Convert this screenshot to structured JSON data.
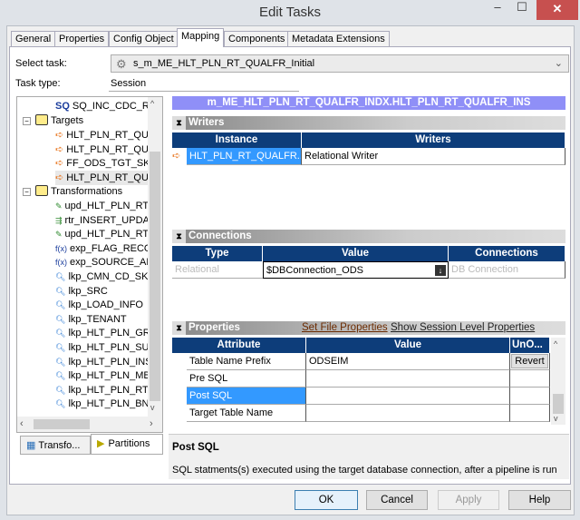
{
  "window": {
    "title": "Edit Tasks",
    "minimize": "–",
    "maximize": "☐",
    "close": "✕"
  },
  "tabs": [
    "General",
    "Properties",
    "Config Object",
    "Mapping",
    "Components",
    "Metadata Extensions"
  ],
  "select_task": {
    "label": "Select task:",
    "value": "s_m_ME_HLT_PLN_RT_QUALFR_Initial"
  },
  "task_type": {
    "label": "Task type:",
    "value": "Session"
  },
  "tree": {
    "sq": "SQ_INC_CDC_RA",
    "targets_label": "Targets",
    "targets": [
      "HLT_PLN_RT_QUA",
      "HLT_PLN_RT_QUA",
      "FF_ODS_TGT_SKI",
      "HLT_PLN_RT_QUA"
    ],
    "transformations_label": "Transformations",
    "transformations": [
      {
        "name": "upd_HLT_PLN_RT_",
        "type": "update"
      },
      {
        "name": "rtr_INSERT_UPDA",
        "type": "router"
      },
      {
        "name": "upd_HLT_PLN_RT_",
        "type": "update"
      },
      {
        "name": "exp_FLAG_RECOF",
        "type": "expression"
      },
      {
        "name": "exp_SOURCE_AN",
        "type": "expression"
      },
      {
        "name": "lkp_CMN_CD_SK_",
        "type": "lookup"
      },
      {
        "name": "lkp_SRC",
        "type": "lookup"
      },
      {
        "name": "lkp_LOAD_INFO",
        "type": "lookup"
      },
      {
        "name": "lkp_TENANT",
        "type": "lookup"
      },
      {
        "name": "lkp_HLT_PLN_GRC",
        "type": "lookup"
      },
      {
        "name": "lkp_HLT_PLN_SUB",
        "type": "lookup"
      },
      {
        "name": "lkp_HLT_PLN_INSF",
        "type": "lookup"
      },
      {
        "name": "lkp_HLT_PLN_MBR",
        "type": "lookup"
      },
      {
        "name": "lkp_HLT_PLN_RT_",
        "type": "lookup"
      },
      {
        "name": "lkp_HLT_PLN_BNF",
        "type": "lookup"
      }
    ]
  },
  "bottom_tabs": [
    "Transfo...",
    "Partitions"
  ],
  "mapping_title": "m_ME_HLT_PLN_RT_QUALFR_INDX.HLT_PLN_RT_QUALFR_INS",
  "writers": {
    "title": "Writers",
    "headers": [
      "Instance",
      "Writers"
    ],
    "rows": [
      [
        "HLT_PLN_RT_QUALFR...",
        "Relational Writer"
      ]
    ]
  },
  "connections": {
    "title": "Connections",
    "headers": [
      "Type",
      "Value",
      "Connections"
    ],
    "rows": [
      [
        "Relational",
        "$DBConnection_ODS",
        "DB Connection"
      ]
    ]
  },
  "properties": {
    "title": "Properties",
    "link1": "Set File Properties",
    "link2": "Show Session Level Properties",
    "headers": [
      "Attribute",
      "Value",
      "UnO..."
    ],
    "rows": [
      [
        "Table Name Prefix",
        "ODSEIM",
        "Revert"
      ],
      [
        "Pre SQL",
        "",
        ""
      ],
      [
        "Post SQL",
        "",
        ""
      ],
      [
        "Target Table Name",
        "",
        ""
      ]
    ],
    "selected": "Post SQL"
  },
  "description": {
    "title": "Post SQL",
    "text": "SQL statments(s) executed using the target database connection, after a pipeline is run"
  },
  "buttons": {
    "ok": "OK",
    "cancel": "Cancel",
    "apply": "Apply",
    "help": "Help"
  },
  "colors": {
    "header": "#0d3d7a",
    "selection": "#3399ff",
    "mapping_title": "#8f8ff7",
    "close": "#c7504f"
  }
}
